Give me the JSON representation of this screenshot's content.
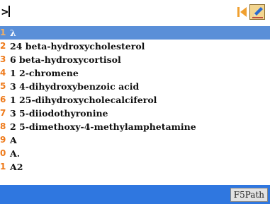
{
  "input": {
    "prompt_glyph": ">",
    "value": ""
  },
  "toolbar": {
    "prev_icon": "prev-page-icon",
    "edit_icon": "edit-pencil-icon"
  },
  "list": {
    "items": [
      {
        "num": "1",
        "label": "λ",
        "selected": true
      },
      {
        "num": "2",
        "label": "24 beta-hydroxycholesterol"
      },
      {
        "num": "3",
        "label": "6 beta-hydroxycortisol"
      },
      {
        "num": "4",
        "label": "1 2-chromene"
      },
      {
        "num": "5",
        "label": "3 4-dihydroxybenzoic acid"
      },
      {
        "num": "6",
        "label": "1 25-dihydroxycholecalciferol"
      },
      {
        "num": "7",
        "label": "3 5-diiodothyronine"
      },
      {
        "num": "8",
        "label": "2 5-dimethoxy-4-methylamphetamine"
      },
      {
        "num": "9",
        "label": "A"
      },
      {
        "num": "0",
        "label": "A."
      },
      {
        "num": "1",
        "label": "A2"
      }
    ]
  },
  "bottom": {
    "f5_label": "F5Path"
  },
  "colors": {
    "selection": "#5a8fd8",
    "bottom_bar": "#2f77e0",
    "number": "#ee7a1a"
  }
}
